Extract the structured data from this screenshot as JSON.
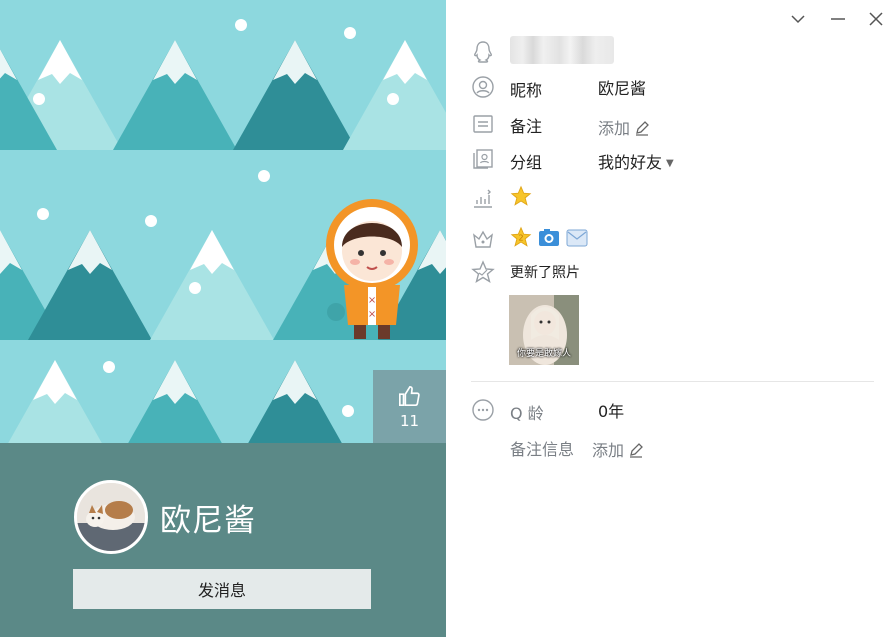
{
  "left": {
    "like_count": "11",
    "nickname": "欧尼酱",
    "send_button": "发消息"
  },
  "right": {
    "window": {
      "icons": [
        "chevron-down-icon",
        "minimize-icon",
        "close-icon"
      ]
    },
    "nickname_label": "昵称",
    "nickname_value": "欧尼酱",
    "remark_label": "备注",
    "remark_value": "添加",
    "group_label": "分组",
    "group_value": "我的好友",
    "activity_text": "更新了照片",
    "thumb_caption": "你要是敢嫁人",
    "qage_label": "Q 龄",
    "qage_value": "0年",
    "remark_info_label": "备注信息",
    "remark_info_value": "添加"
  },
  "colors": {
    "banner_bg": "#8dd8de",
    "profile_bg": "#5b8987",
    "send_button_bg": "#e4eaea",
    "muted_text": "#7a7f85"
  }
}
